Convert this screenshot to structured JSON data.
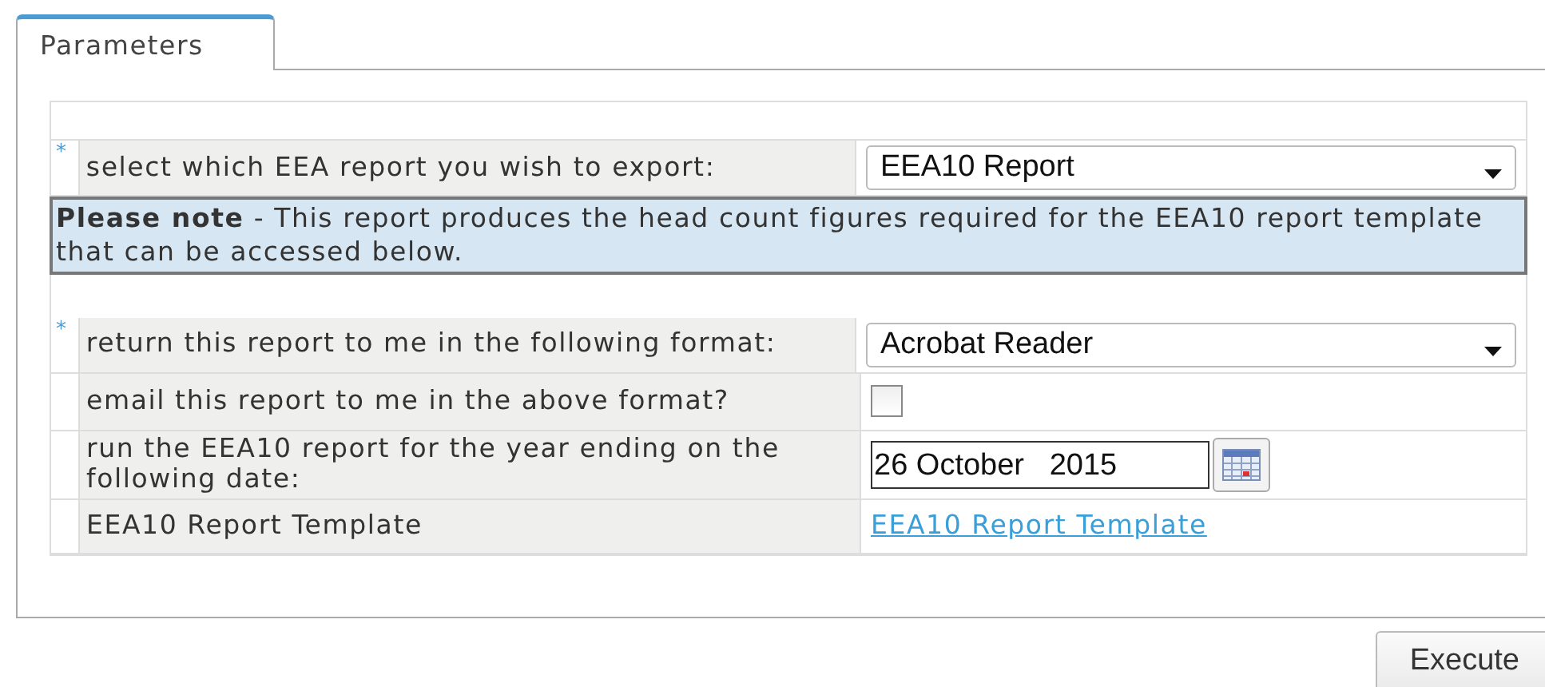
{
  "tabs": [
    {
      "label": "Parameters",
      "selected": true
    }
  ],
  "rows": [
    {
      "kind": "select",
      "marker": "*",
      "label": "select which EEA report you wish to export:",
      "value": "EEA10 Report"
    },
    {
      "kind": "note",
      "text": "**Please note** - This report produces the head count figures required for the EEA10 report template that can be accessed below."
    },
    {
      "kind": "spacer"
    },
    {
      "kind": "select",
      "marker": "*",
      "label": "return this report to me in the following format:",
      "value": "Acrobat Reader"
    },
    {
      "kind": "checkbox",
      "label": "email this report to me in the above format?",
      "checked": false
    },
    {
      "kind": "date",
      "label": "run the EEA10 report for the year ending on the following date:",
      "value": "26 October   2015"
    },
    {
      "kind": "link",
      "label": "EEA10 Report Template",
      "value": "EEA10 Report Template"
    }
  ],
  "buttons": [
    {
      "label": "Execute"
    }
  ]
}
